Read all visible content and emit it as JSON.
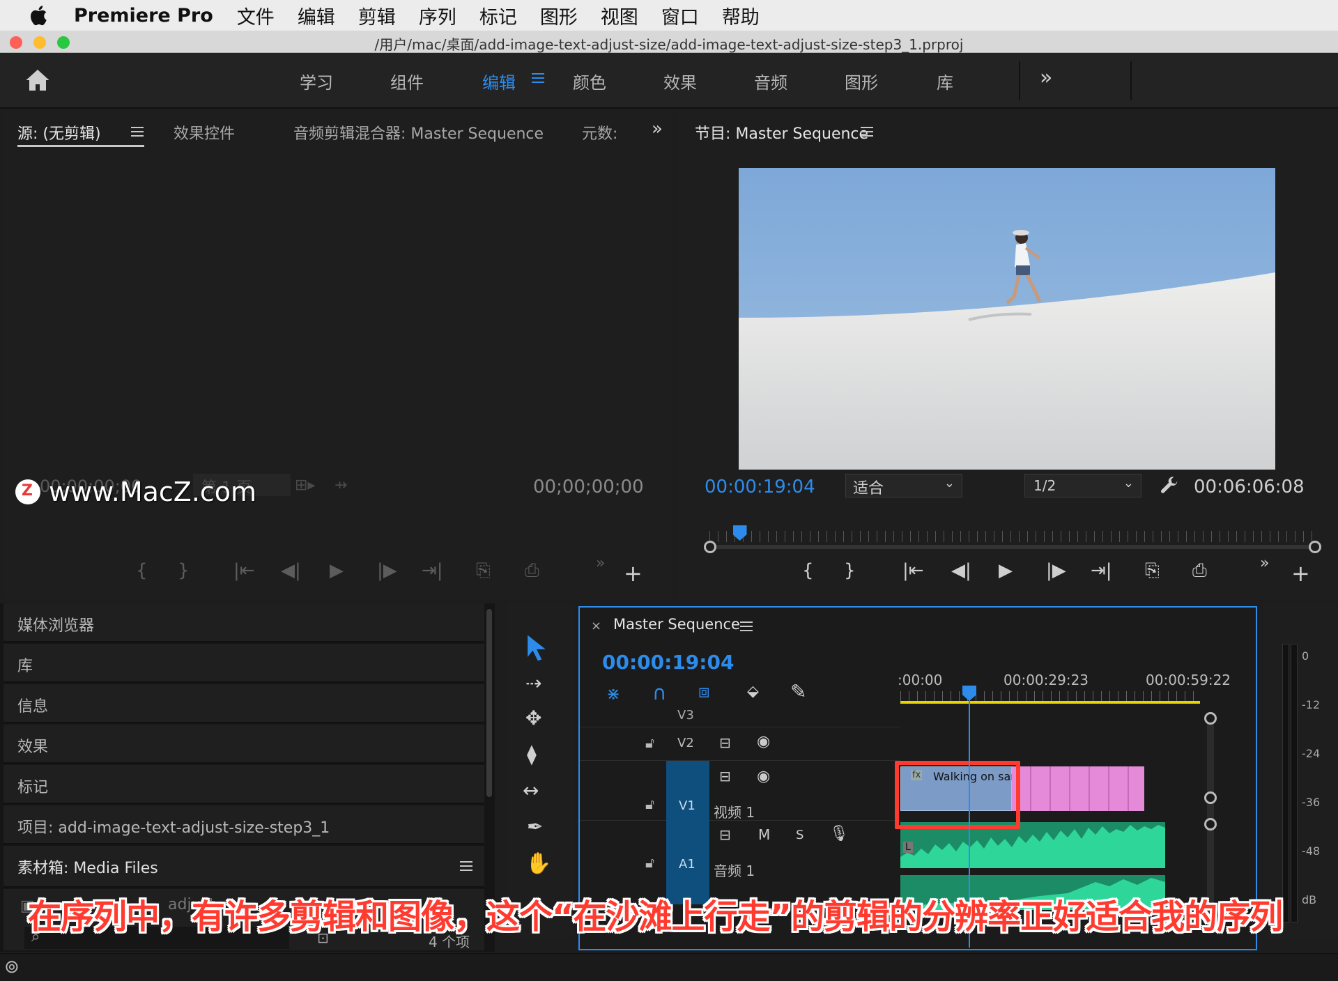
{
  "menubar": {
    "app": "Premiere Pro",
    "items": [
      "文件",
      "编辑",
      "剪辑",
      "序列",
      "标记",
      "图形",
      "视图",
      "窗口",
      "帮助"
    ]
  },
  "window": {
    "title": "/用户/mac/桌面/add-image-text-adjust-size/add-image-text-adjust-size-step3_1.prproj"
  },
  "workspaces": {
    "items": [
      "学习",
      "组件",
      "编辑",
      "颜色",
      "效果",
      "音频",
      "图形",
      "库"
    ],
    "active": "编辑",
    "more": "»"
  },
  "source_panel": {
    "tabs": [
      "源: (无剪辑)",
      "效果控件",
      "音频剪辑混合器: Master Sequence",
      "元数:"
    ],
    "more": "»",
    "timecode_left": "00;00;00;00",
    "page": "第 1 页",
    "timecode_right": "00;00;00;00"
  },
  "program_panel": {
    "title": "节目: Master Sequence",
    "timecode": "00:00:19:04",
    "zoom": "适合",
    "resolution": "1/2",
    "duration": "00:06:06:08",
    "playhead_fraction": 0.05
  },
  "left_panel": {
    "items": [
      "媒体浏览器",
      "库",
      "信息",
      "效果",
      "标记"
    ],
    "project": "项目: add-image-text-adjust-size-step3_1",
    "bin": "素材箱: Media Files",
    "bin_search": "adjust",
    "count": "4 个项"
  },
  "timeline": {
    "title": "Master Sequence",
    "timecode": "00:00:19:04",
    "ruler": [
      ":00:00",
      "00:00:29:23",
      "00:00:59:22"
    ],
    "tracks": {
      "v3": "V3",
      "v2": "V2",
      "v1": "V1",
      "v1_name": "视频 1",
      "a1": "A1",
      "a1_name": "音频 1",
      "mute": "M",
      "solo": "S",
      "v1_src": "V1",
      "a1_src": "A1"
    },
    "clip_name": "Walking on sand",
    "fx": "fx",
    "audio_channel": "L"
  },
  "meter": {
    "labels": [
      "0",
      "-12",
      "-24",
      "-36",
      "-48",
      "dB"
    ]
  },
  "watermark": "www.MacZ.com",
  "watermark_badge": "Z",
  "caption": "在序列中，有许多剪辑和图像，这个“在沙滩上行走”的剪辑的分辨率正好适合我的序列",
  "colors": {
    "accent_blue": "#2d8ceb",
    "clip_blue": "#7c9bc7",
    "clip_pink": "#e58ad9",
    "audio_green": "#2fd69a",
    "highlight_red": "#ff3b30"
  }
}
